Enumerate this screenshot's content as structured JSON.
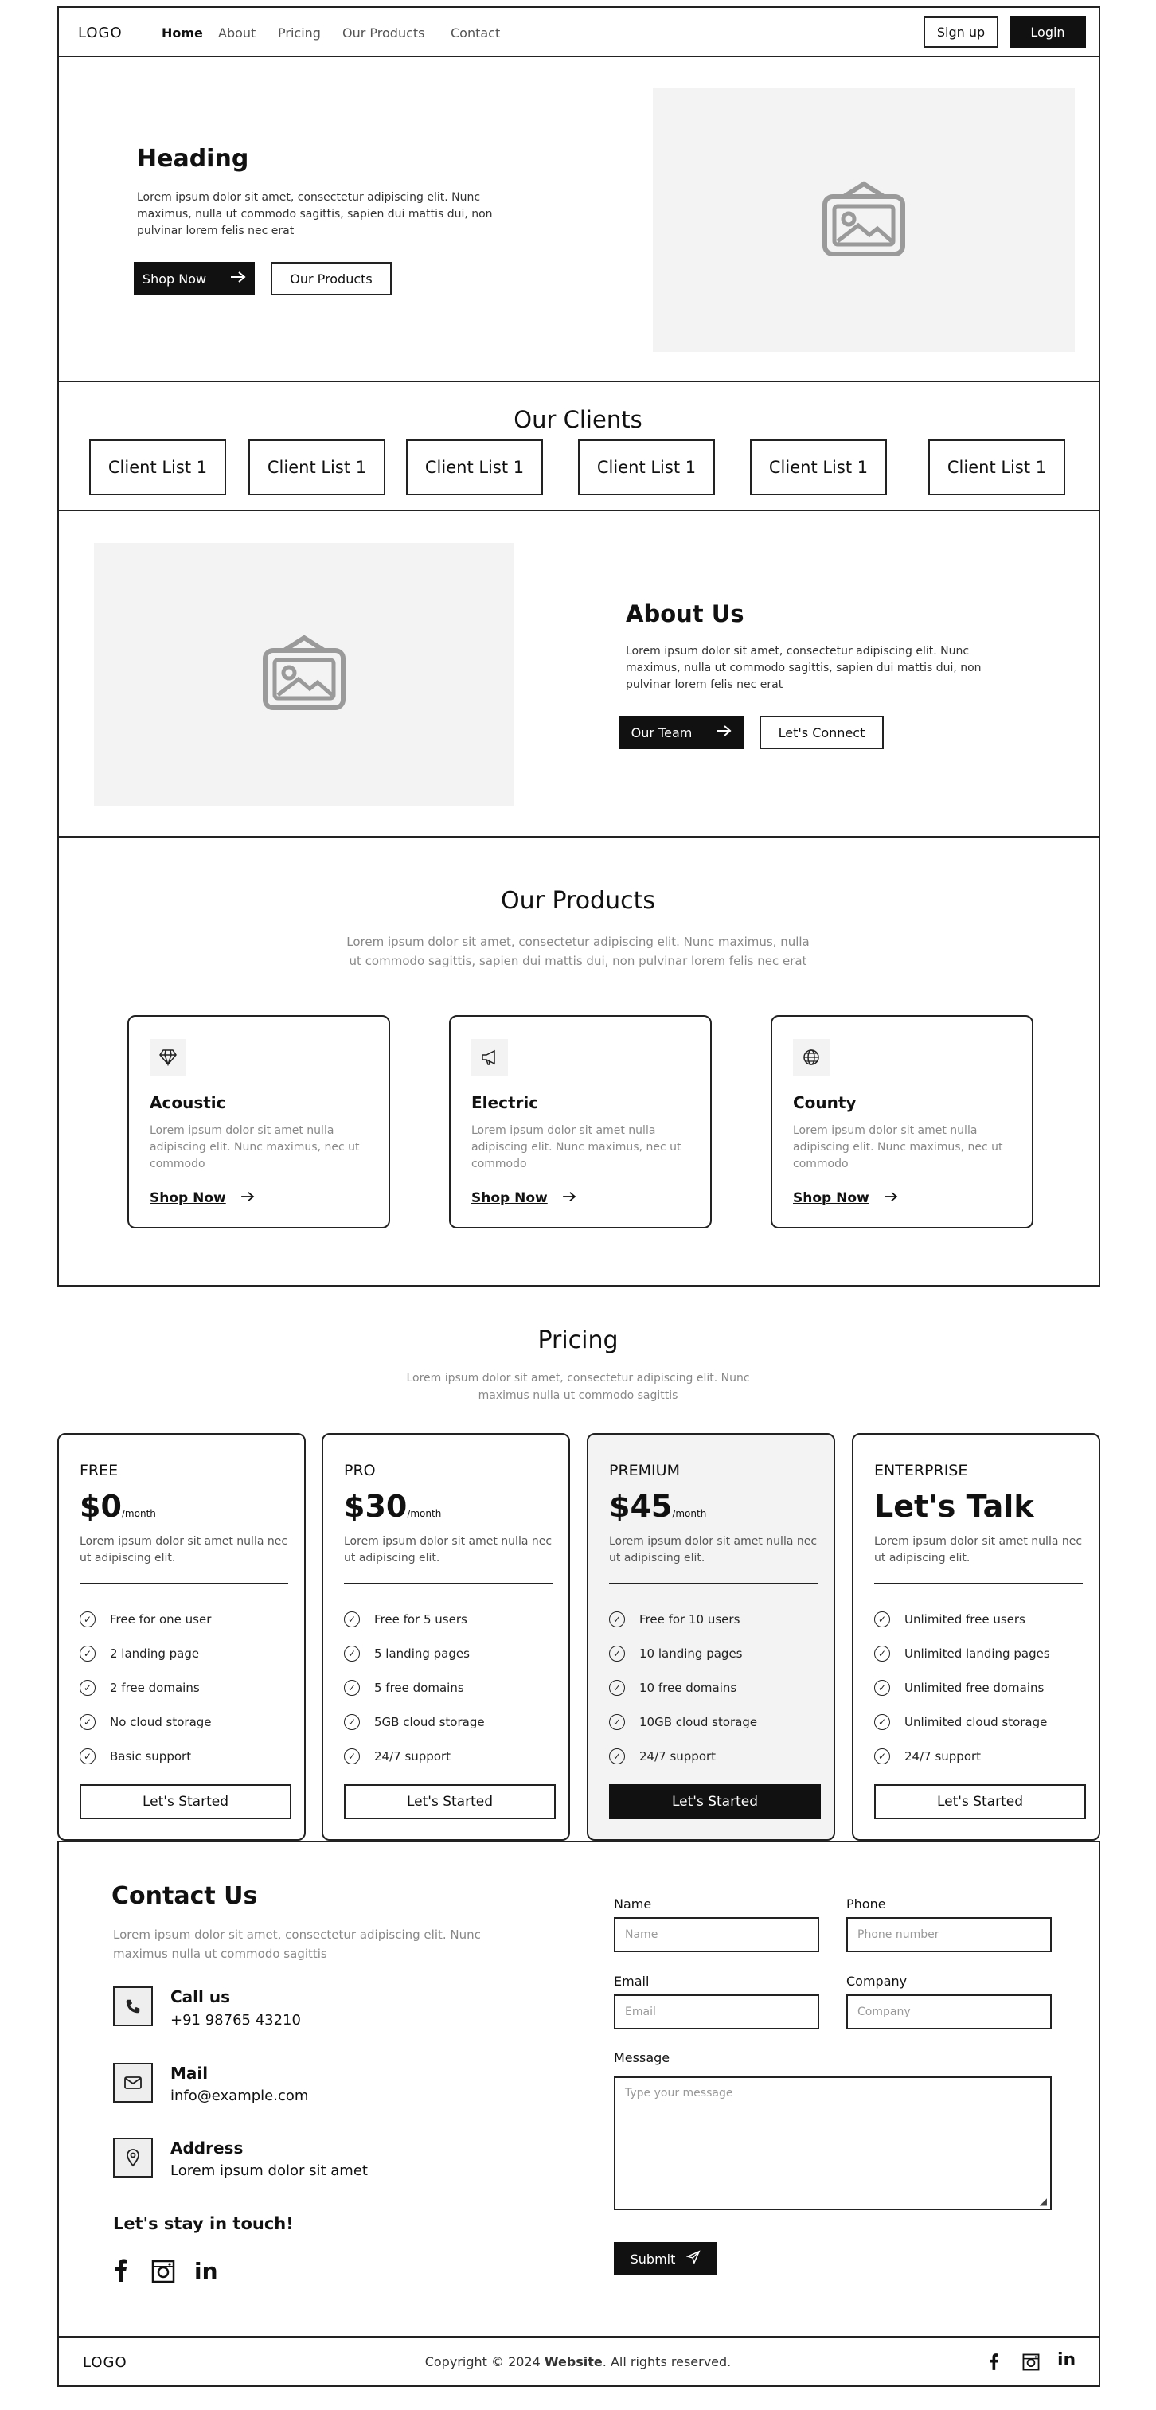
{
  "nav": {
    "logo": "LOGO",
    "links": [
      "Home",
      "About",
      "Pricing",
      "Our Products",
      "Contact"
    ],
    "signup": "Sign up",
    "login": "Login"
  },
  "hero": {
    "heading": "Heading",
    "text": "Lorem ipsum dolor sit amet, consectetur adipiscing elit. Nunc maximus, nulla ut commodo sagittis, sapien dui mattis dui, non pulvinar lorem felis nec erat",
    "primary_button": "Shop Now",
    "secondary_button": "Our Products"
  },
  "clients": {
    "title": "Our Clients",
    "items": [
      "Client List 1",
      "Client List 1",
      "Client List 1",
      "Client List 1",
      "Client List 1",
      "Client List 1"
    ]
  },
  "about": {
    "title": "About Us",
    "text": "Lorem ipsum dolor sit amet, consectetur adipiscing elit. Nunc maximus, nulla ut commodo sagittis, sapien dui mattis dui, non pulvinar lorem felis nec erat",
    "primary_button": "Our Team",
    "secondary_button": "Let's Connect"
  },
  "products": {
    "title": "Our Products",
    "text": "Lorem ipsum dolor sit amet, consectetur adipiscing elit. Nunc maximus, nulla ut commodo sagittis, sapien dui mattis dui, non pulvinar lorem felis nec erat",
    "items": [
      {
        "icon": "diamond-icon",
        "title": "Acoustic",
        "text": "Lorem ipsum dolor sit amet nulla adipiscing elit. Nunc maximus, nec ut commodo",
        "link": "Shop Now"
      },
      {
        "icon": "megaphone-icon",
        "title": "Electric",
        "text": "Lorem ipsum dolor sit amet nulla adipiscing elit. Nunc maximus, nec ut commodo",
        "link": "Shop Now"
      },
      {
        "icon": "globe-icon",
        "title": "County",
        "text": "Lorem ipsum dolor sit amet nulla adipiscing elit. Nunc maximus, nec ut commodo",
        "link": "Shop Now"
      }
    ]
  },
  "pricing": {
    "title": "Pricing",
    "text": "Lorem ipsum dolor sit amet, consectetur adipiscing elit. Nunc maximus nulla ut commodo sagittis",
    "plans": [
      {
        "name": "FREE",
        "price": "$0",
        "period": "/month",
        "desc": "Lorem ipsum dolor sit amet nulla nec ut adipiscing elit.",
        "features": [
          "Free for one user",
          "2 landing page",
          "2 free domains",
          "No cloud storage",
          "Basic support"
        ],
        "button": "Let's Started"
      },
      {
        "name": "PRO",
        "price": "$30",
        "period": "/month",
        "desc": "Lorem ipsum dolor sit amet nulla nec ut adipiscing elit.",
        "features": [
          "Free for 5 users",
          "5 landing pages",
          "5 free domains",
          "5GB cloud storage",
          "24/7 support"
        ],
        "button": "Let's Started"
      },
      {
        "name": "PREMIUM",
        "price": "$45",
        "period": "/month",
        "desc": "Lorem ipsum dolor sit amet nulla nec ut adipiscing elit.",
        "features": [
          "Free for 10 users",
          "10 landing pages",
          "10 free domains",
          "10GB cloud storage",
          "24/7 support"
        ],
        "button": "Let's Started"
      },
      {
        "name": "ENTERPRISE",
        "price": "Let's Talk",
        "period": "",
        "desc": "Lorem ipsum dolor sit amet nulla nec ut adipiscing elit.",
        "features": [
          "Unlimited free users",
          "Unlimited landing pages",
          "Unlimited free domains",
          "Unlimited cloud storage",
          "24/7 support"
        ],
        "button": "Let's Started"
      }
    ]
  },
  "contact": {
    "title": "Contact Us",
    "text": "Lorem ipsum dolor sit amet, consectetur adipiscing elit. Nunc maximus nulla ut commodo sagittis",
    "call_title": "Call us",
    "call_value": "+91 98765 43210",
    "mail_title": "Mail",
    "mail_value": "info@example.com",
    "address_title": "Address",
    "address_value": "Lorem ipsum dolor sit amet",
    "stay": "Let's stay in touch!",
    "form": {
      "name_label": "Name",
      "name_placeholder": "Name",
      "phone_label": "Phone",
      "phone_placeholder": "Phone number",
      "email_label": "Email",
      "email_placeholder": "Email",
      "company_label": "Company",
      "company_placeholder": "Company",
      "message_label": "Message",
      "message_placeholder": "Type your message",
      "submit": "Submit"
    }
  },
  "footer": {
    "logo": "LOGO",
    "copy_prefix": "Copyright © 2024 ",
    "copy_site": "Website",
    "copy_suffix": ". All rights reserved."
  }
}
